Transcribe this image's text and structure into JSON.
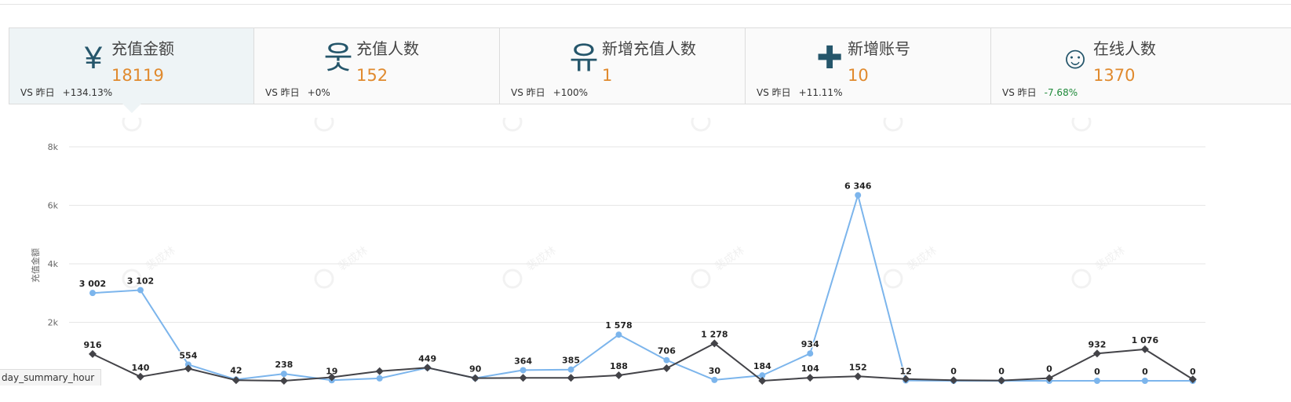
{
  "cards": [
    {
      "icon": "yen-icon",
      "glyph": "¥",
      "title": "充值金额",
      "value": "18119",
      "vs_label": "VS 昨日",
      "change": "+134.13%"
    },
    {
      "icon": "person-icon",
      "glyph": "웃",
      "title": "充值人数",
      "value": "152",
      "vs_label": "VS 昨日",
      "change": "+0%"
    },
    {
      "icon": "new-person-icon",
      "glyph": "유",
      "title": "新增充值人数",
      "value": "1",
      "vs_label": "VS 昨日",
      "change": "+100%"
    },
    {
      "icon": "plus-icon",
      "glyph": "✚",
      "title": "新增账号",
      "value": "10",
      "vs_label": "VS 昨日",
      "change": "+11.11%"
    },
    {
      "icon": "smiley-icon",
      "glyph": "☺",
      "title": "在线人数",
      "value": "1370",
      "vs_label": "VS 昨日",
      "change": "-7.68%"
    }
  ],
  "watermark": "裴成林",
  "tooltip": "day_summary_hour",
  "colors": {
    "series_today": "#7cb5ec",
    "series_yesterday": "#434348",
    "value": "#e08a2e",
    "icon": "#25566b",
    "negative": "#1f8a3a"
  },
  "chart_data": {
    "type": "line",
    "ylabel": "充值金额",
    "ylim": [
      0,
      8000
    ],
    "yticks": [
      2000,
      4000,
      6000,
      8000
    ],
    "ytick_labels": [
      "2k",
      "4k",
      "6k",
      "8k"
    ],
    "x": [
      0,
      1,
      2,
      3,
      4,
      5,
      6,
      7,
      8,
      9,
      10,
      11,
      12,
      13,
      14,
      15,
      16,
      17,
      18,
      19,
      20,
      21,
      22,
      23
    ],
    "grid": true,
    "series": [
      {
        "values": [
          3002,
          3102,
          554,
          42,
          238,
          19,
          84,
          449,
          90,
          364,
          385,
          1578,
          706,
          30,
          184,
          934,
          6346,
          12,
          0,
          0,
          0,
          0,
          0,
          0
        ],
        "labels": [
          "3 002",
          "3 102",
          "554",
          "42",
          "238",
          "19",
          "84",
          "449",
          "90",
          "364",
          "385",
          "1 578",
          "706",
          "30",
          "184",
          "934",
          "6 346",
          "12",
          "0",
          "0",
          "0",
          "0",
          "0",
          "0"
        ],
        "show_label": [
          true,
          true,
          true,
          true,
          true,
          true,
          false,
          false,
          false,
          true,
          true,
          true,
          true,
          true,
          true,
          true,
          true,
          true,
          false,
          false,
          false,
          true,
          true,
          true
        ]
      },
      {
        "values": [
          916,
          140,
          420,
          20,
          0,
          120,
          330,
          449,
          90,
          100,
          100,
          188,
          430,
          1278,
          0,
          104,
          152,
          60,
          20,
          10,
          90,
          932,
          1076,
          50
        ],
        "labels": [
          "916",
          "140",
          "",
          "",
          "",
          "",
          "",
          "449",
          "90",
          "",
          "",
          "188",
          "",
          "1 278",
          "",
          "104",
          "152",
          "",
          "0",
          "0",
          "0",
          "932",
          "1 076",
          ""
        ],
        "show_label": [
          true,
          true,
          false,
          false,
          false,
          false,
          false,
          true,
          true,
          false,
          false,
          true,
          false,
          true,
          false,
          true,
          true,
          false,
          true,
          true,
          true,
          true,
          true,
          false
        ]
      }
    ]
  }
}
